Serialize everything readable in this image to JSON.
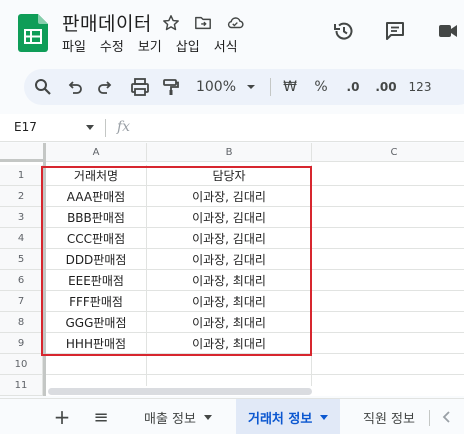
{
  "doc": {
    "title": "판매데이터"
  },
  "menu": [
    "파일",
    "수정",
    "보기",
    "삽입",
    "서식"
  ],
  "toolbar": {
    "zoom": "100%",
    "currency": "₩",
    "percent": "%",
    "dec_less": ".0",
    "dec_more": ".00",
    "format_123": "123"
  },
  "formula_bar": {
    "cell_ref": "E17",
    "fx": "fx"
  },
  "columns": [
    "A",
    "B",
    "C"
  ],
  "rows": [
    "1",
    "2",
    "3",
    "4",
    "5",
    "6",
    "7",
    "8",
    "9",
    "10",
    "11"
  ],
  "table": [
    [
      "거래처명",
      "담당자"
    ],
    [
      "AAA판매점",
      "이과장, 김대리"
    ],
    [
      "BBB판매점",
      "이과장, 김대리"
    ],
    [
      "CCC판매점",
      "이과장, 김대리"
    ],
    [
      "DDD판매점",
      "이과장, 김대리"
    ],
    [
      "EEE판매점",
      "이과장, 최대리"
    ],
    [
      "FFF판매점",
      "이과장, 최대리"
    ],
    [
      "GGG판매점",
      "이과장, 최대리"
    ],
    [
      "HHH판매점",
      "이과장, 최대리"
    ]
  ],
  "sheets": {
    "add": "+",
    "list": "≡",
    "tabs": [
      "매출 정보",
      "거래처 정보",
      "직원 정보"
    ],
    "active": "거래처 정보"
  },
  "colors": {
    "accent": "#0b57d0",
    "highlight_border": "#d7262e",
    "sheets_green": "#0f9d58"
  }
}
